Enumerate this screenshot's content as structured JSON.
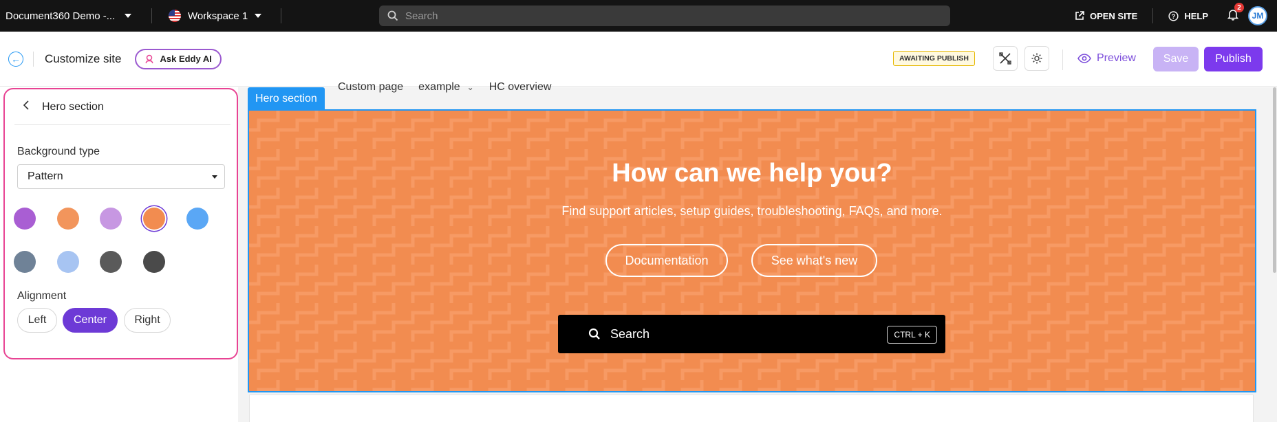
{
  "topbar": {
    "project_name": "Document360 Demo -...",
    "workspace": "Workspace 1",
    "search_placeholder": "Search",
    "open_site": "OPEN SITE",
    "help": "HELP",
    "notifications_count": "2",
    "avatar_initials": "JM"
  },
  "subbar": {
    "title": "Customize site",
    "ask_eddy": "Ask Eddy AI",
    "status": "AWAITING PUBLISH",
    "preview": "Preview",
    "save": "Save",
    "publish": "Publish"
  },
  "panel": {
    "title": "Hero section",
    "background_type_label": "Background type",
    "background_type_value": "Pattern",
    "swatches": [
      {
        "color": "#a95ed3",
        "selected": false
      },
      {
        "color": "#f2955c",
        "selected": false
      },
      {
        "color": "#c797e2",
        "selected": false
      },
      {
        "color": "#f28c50",
        "selected": true
      },
      {
        "color": "#5aa7f5",
        "selected": false
      },
      {
        "color": "#6f8297",
        "selected": false
      },
      {
        "color": "#a7c4f2",
        "selected": false
      },
      {
        "color": "#5a5a5a",
        "selected": false
      },
      {
        "color": "#4a4a4a",
        "selected": false
      }
    ],
    "alignment_label": "Alignment",
    "alignment_options": [
      "Left",
      "Center",
      "Right"
    ],
    "alignment_selected": "Center"
  },
  "canvas": {
    "nav": [
      "Custom page",
      "example",
      "HC overview"
    ],
    "hero_tag": "Hero section",
    "hero_title": "How can we help you?",
    "hero_subtitle": "Find support articles, setup guides, troubleshooting, FAQs, and more.",
    "buttons": [
      "Documentation",
      "See what's new"
    ],
    "search_label": "Search",
    "search_shortcut": "CTRL + K",
    "hero_color": "#f28c50"
  }
}
